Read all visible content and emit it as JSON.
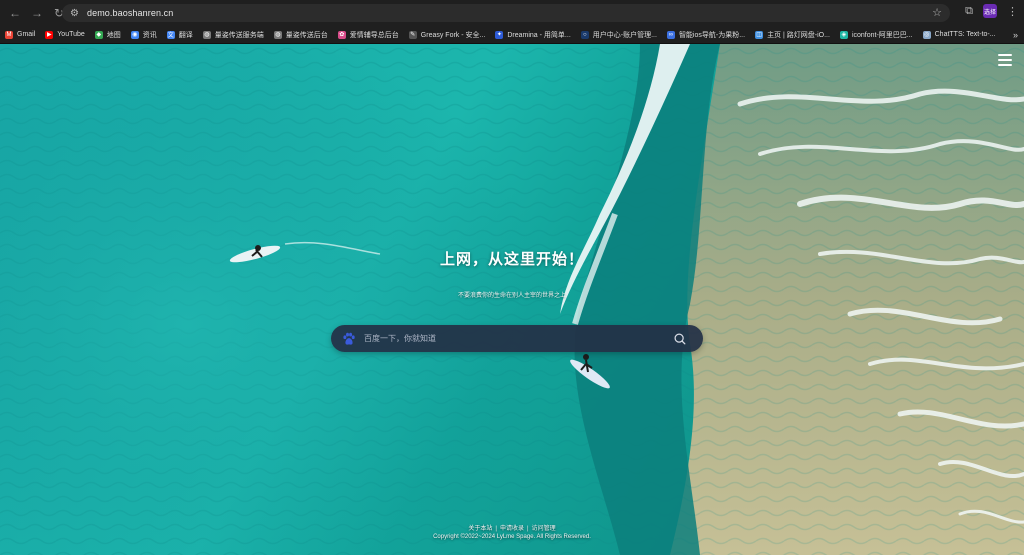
{
  "browser": {
    "url": "demo.baoshanren.cn",
    "profile_badge": "选择"
  },
  "bookmarks": [
    {
      "label": "Gmail",
      "icon": "gmail-icon",
      "color": "#ea4335",
      "glyph": "M"
    },
    {
      "label": "YouTube",
      "icon": "youtube-icon",
      "color": "#ff0000",
      "glyph": "▶"
    },
    {
      "label": "地图",
      "icon": "maps-icon",
      "color": "#34a853",
      "glyph": "◆"
    },
    {
      "label": "资讯",
      "icon": "news-icon",
      "color": "#4285f4",
      "glyph": "◉"
    },
    {
      "label": "翻译",
      "icon": "translate-icon",
      "color": "#4285f4",
      "glyph": "文"
    },
    {
      "label": "量姿传送服务端",
      "icon": "globe-icon",
      "color": "#7a7a7a",
      "glyph": "◍"
    },
    {
      "label": "量姿传送后台",
      "icon": "globe-icon",
      "color": "#7a7a7a",
      "glyph": "◍"
    },
    {
      "label": "爱情辅导总后台",
      "icon": "colorful-icon",
      "color": "#d94c8a",
      "glyph": "✿"
    },
    {
      "label": "Greasy Fork - 安全...",
      "icon": "greasyfork-icon",
      "color": "#555555",
      "glyph": "✎"
    },
    {
      "label": "Dreamina - 用简单...",
      "icon": "dreamina-icon",
      "color": "#2d5bd7",
      "glyph": "✦"
    },
    {
      "label": "用户中心-账户管理...",
      "icon": "user-center-icon",
      "color": "#1a3a6b",
      "glyph": "○"
    },
    {
      "label": "智能ios导航-为果粉...",
      "icon": "ios-nav-icon",
      "color": "#3a6fe0",
      "glyph": "∞"
    },
    {
      "label": "主页 | 路灯网盘-iO...",
      "icon": "drive-icon",
      "color": "#3f8fe0",
      "glyph": "◫"
    },
    {
      "label": "iconfont-阿里巴巴...",
      "icon": "iconfont-icon",
      "color": "#20b6a4",
      "glyph": "◈"
    },
    {
      "label": "ChatTTS: Text-to-...",
      "icon": "chattts-icon",
      "color": "#8aa8c9",
      "glyph": "◎"
    }
  ],
  "hero": {
    "title": "上网，从这里开始！",
    "subtitle": "不要浪费你的生命在别人主宰的世界之上"
  },
  "search": {
    "placeholder": "百度一下，你就知道",
    "engine_icon": "baidu-paw-icon"
  },
  "footer": {
    "links": [
      "关于本站",
      "申请收录",
      "访问管理"
    ],
    "copyright": "Copyright ©2022~2024 LyLme Spage. All Rights Reserved."
  },
  "colors": {
    "search_bg": "#24304A",
    "engine_icon": "#3a5bdc",
    "ocean": "#1ba9a4",
    "sand": "#b9b78f"
  }
}
